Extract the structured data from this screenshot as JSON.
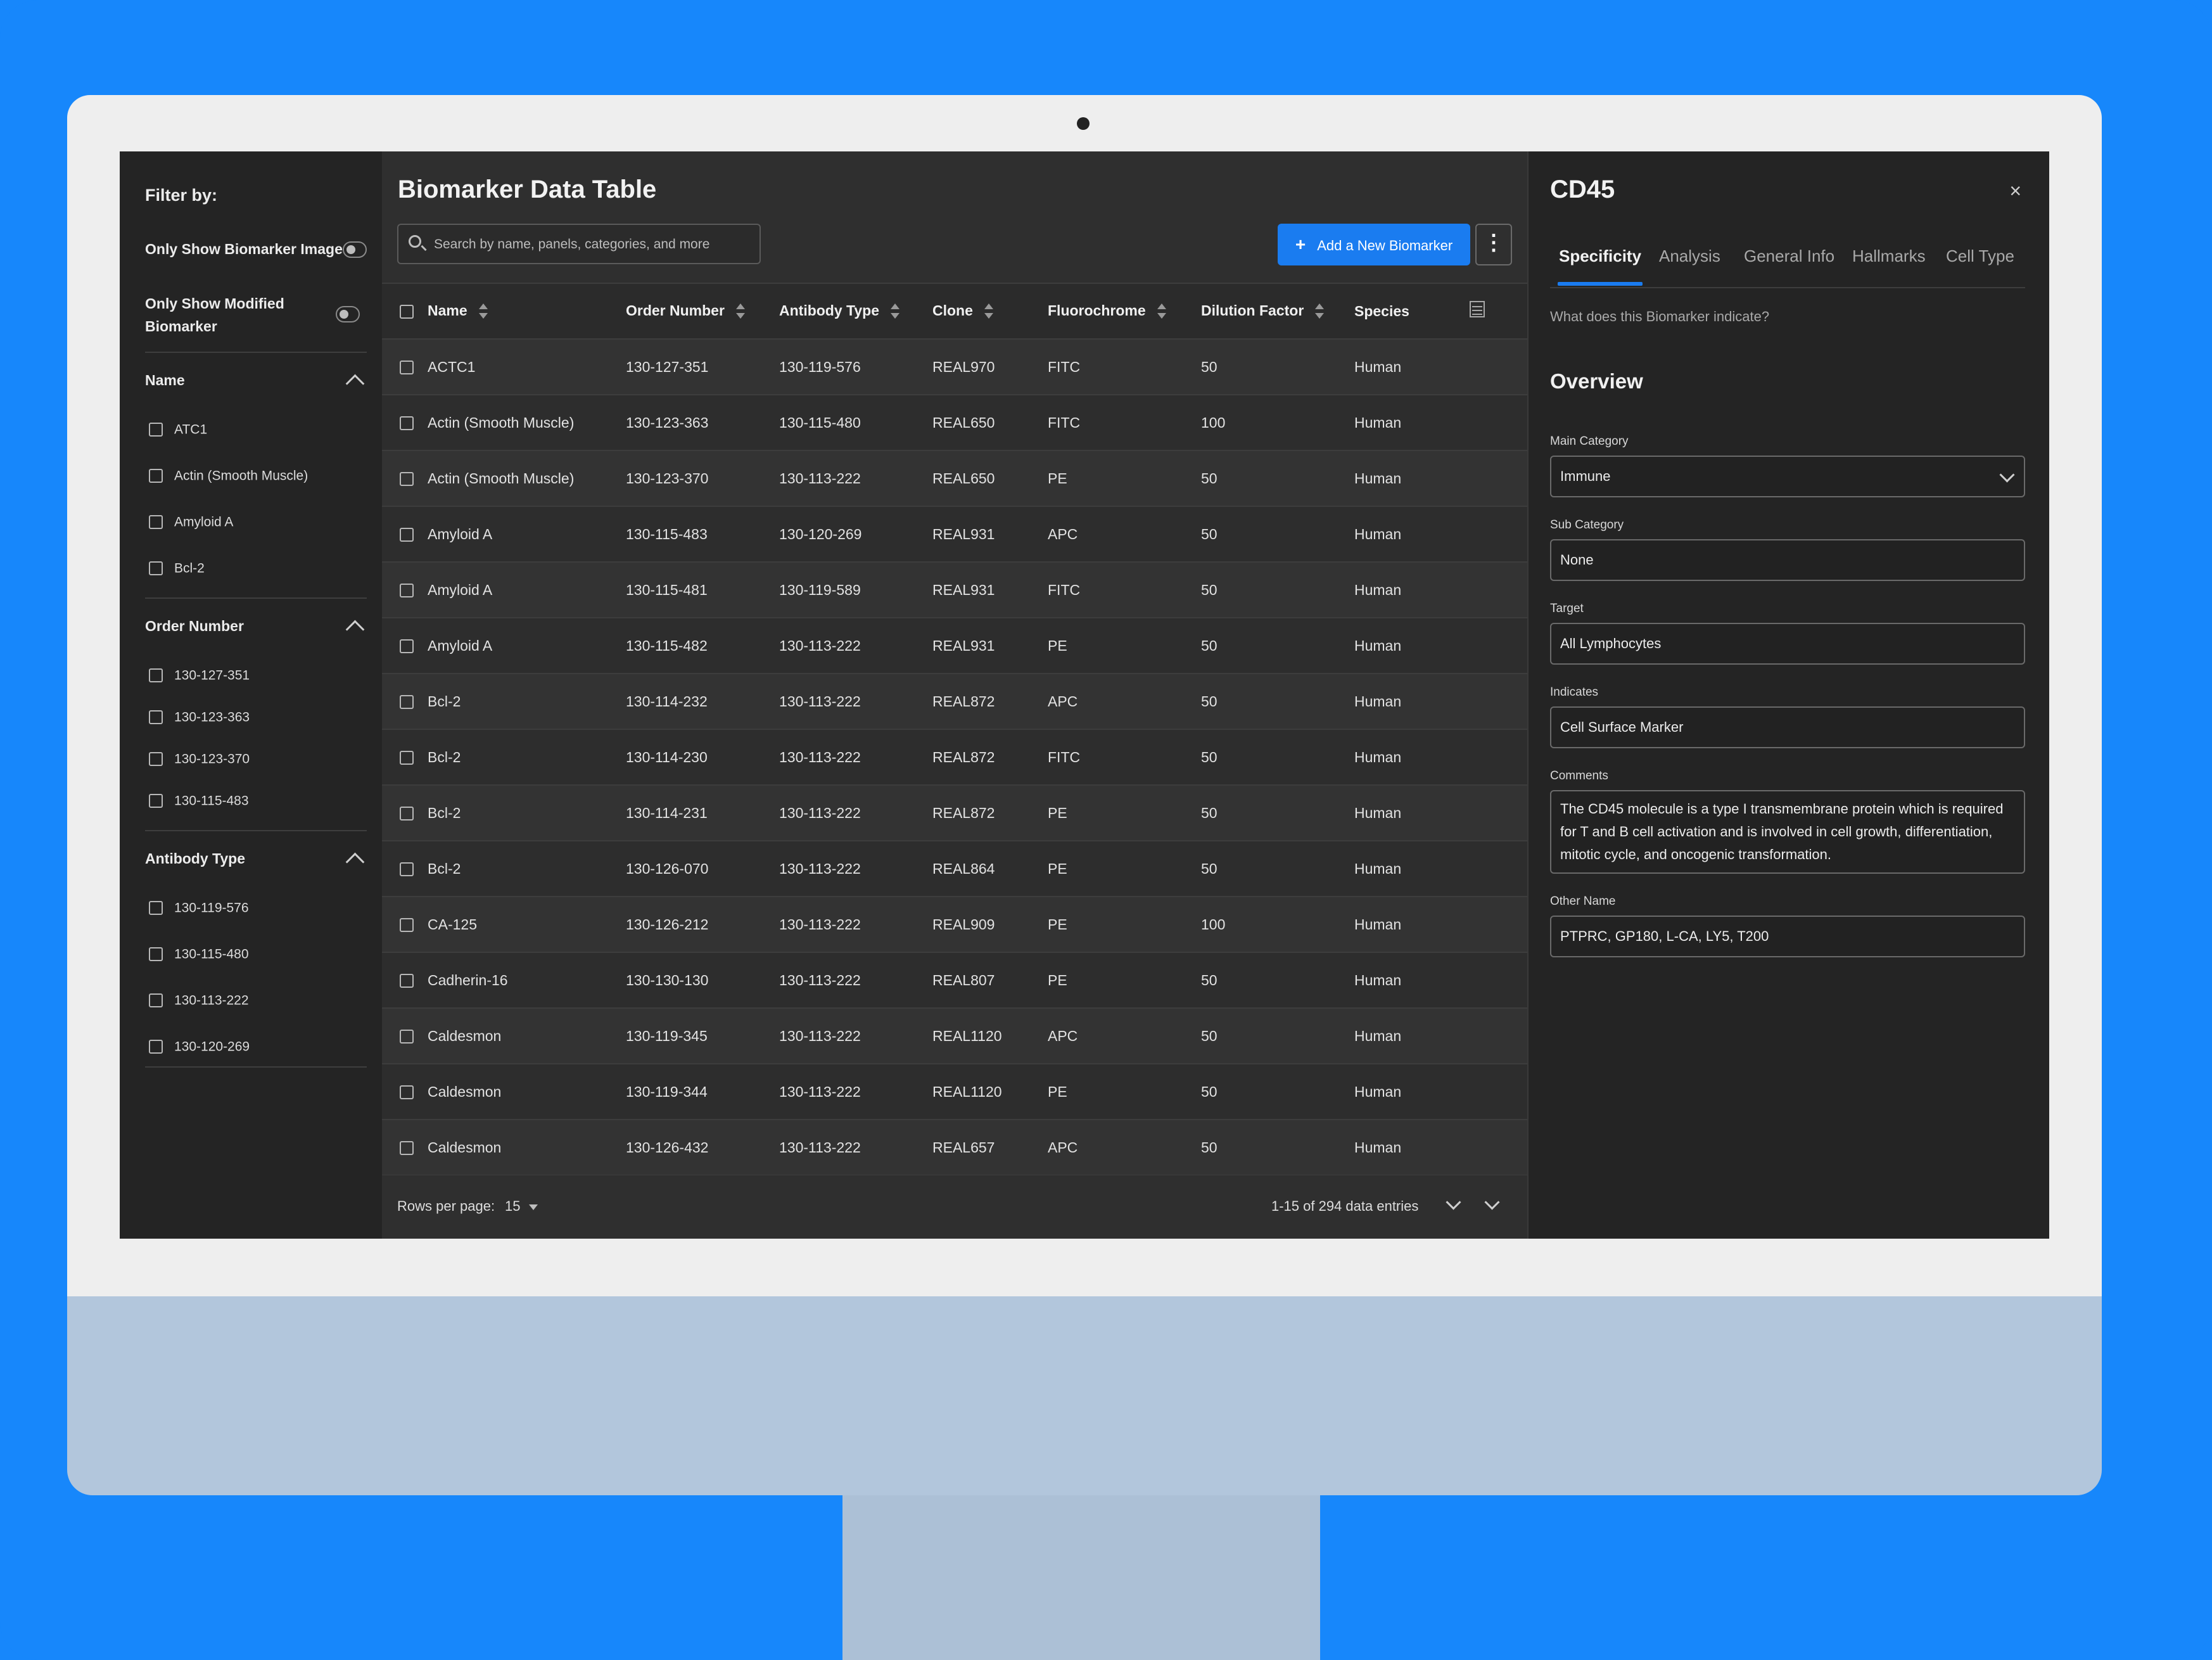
{
  "filter": {
    "title": "Filter by:",
    "toggles": [
      {
        "label": "Only Show Biomarker Image",
        "on": false
      },
      {
        "label": "Only Show Modified Biomarker",
        "on": false
      }
    ],
    "sections": [
      {
        "title": "Name",
        "items": [
          "ATC1",
          "Actin (Smooth Muscle)",
          "Amyloid A",
          "Bcl-2"
        ]
      },
      {
        "title": "Order Number",
        "items": [
          "130-127-351",
          "130-123-363",
          "130-123-370",
          "130-115-483"
        ]
      },
      {
        "title": "Antibody Type",
        "items": [
          "130-119-576",
          "130-115-480",
          "130-113-222",
          "130-120-269"
        ]
      }
    ]
  },
  "main": {
    "title": "Biomarker Data Table",
    "search_placeholder": "Search by name, panels, categories, and more",
    "add_button": "Add a New Biomarker",
    "add_icon": "+",
    "columns": [
      "Name",
      "Order Number",
      "Antibody Type",
      "Clone",
      "Fluorochrome",
      "Dilution Factor",
      "Species"
    ],
    "rows": [
      [
        "ACTC1",
        "130-127-351",
        "130-119-576",
        "REAL970",
        "FITC",
        "50",
        "Human"
      ],
      [
        "Actin (Smooth Muscle)",
        "130-123-363",
        "130-115-480",
        "REAL650",
        "FITC",
        "100",
        "Human"
      ],
      [
        "Actin (Smooth Muscle)",
        "130-123-370",
        "130-113-222",
        "REAL650",
        "PE",
        "50",
        "Human"
      ],
      [
        "Amyloid A",
        "130-115-483",
        "130-120-269",
        "REAL931",
        "APC",
        "50",
        "Human"
      ],
      [
        "Amyloid A",
        "130-115-481",
        "130-119-589",
        "REAL931",
        "FITC",
        "50",
        "Human"
      ],
      [
        "Amyloid A",
        "130-115-482",
        "130-113-222",
        "REAL931",
        "PE",
        "50",
        "Human"
      ],
      [
        "Bcl-2",
        "130-114-232",
        "130-113-222",
        "REAL872",
        "APC",
        "50",
        "Human"
      ],
      [
        "Bcl-2",
        "130-114-230",
        "130-113-222",
        "REAL872",
        "FITC",
        "50",
        "Human"
      ],
      [
        "Bcl-2",
        "130-114-231",
        "130-113-222",
        "REAL872",
        "PE",
        "50",
        "Human"
      ],
      [
        "Bcl-2",
        "130-126-070",
        "130-113-222",
        "REAL864",
        "PE",
        "50",
        "Human"
      ],
      [
        "CA-125",
        "130-126-212",
        "130-113-222",
        "REAL909",
        "PE",
        "100",
        "Human"
      ],
      [
        "Cadherin-16",
        "130-130-130",
        "130-113-222",
        "REAL807",
        "PE",
        "50",
        "Human"
      ],
      [
        "Caldesmon",
        "130-119-345",
        "130-113-222",
        "REAL1120",
        "APC",
        "50",
        "Human"
      ],
      [
        "Caldesmon",
        "130-119-344",
        "130-113-222",
        "REAL1120",
        "PE",
        "50",
        "Human"
      ],
      [
        "Caldesmon",
        "130-126-432",
        "130-113-222",
        "REAL657",
        "APC",
        "50",
        "Human"
      ]
    ],
    "footer": {
      "rows_per_page_label": "Rows per page:",
      "rows_per_page": "15",
      "count": "1-15 of 294 data entries"
    }
  },
  "detail": {
    "title": "CD45",
    "close": "×",
    "tabs": [
      "Specificity",
      "Analysis",
      "General Info",
      "Hallmarks",
      "Cell Type"
    ],
    "active_tab": "Specificity",
    "question": "What does this Biomarker indicate?",
    "overview": "Overview",
    "main_category_label": "Main Category",
    "main_category": "Immune",
    "sub_category_label": "Sub Category",
    "sub_category": "None",
    "target_label": "Target",
    "target": "All Lymphocytes",
    "indicates_label": "Indicates",
    "indicates": "Cell Surface Marker",
    "comments_label": "Comments",
    "comments": "The CD45 molecule is a type I transmembrane protein which is required for T and B cell activation and is involved in cell growth, differentiation, mitotic cycle, and oncogenic transformation.",
    "other_name_label": "Other Name",
    "other_name": "PTPRC, GP180, L-CA, LY5, T200"
  },
  "colors": {
    "accent": "#1a7cf0",
    "background": "#1787fb",
    "panel": "#242424",
    "table": "#2f2f2f"
  }
}
